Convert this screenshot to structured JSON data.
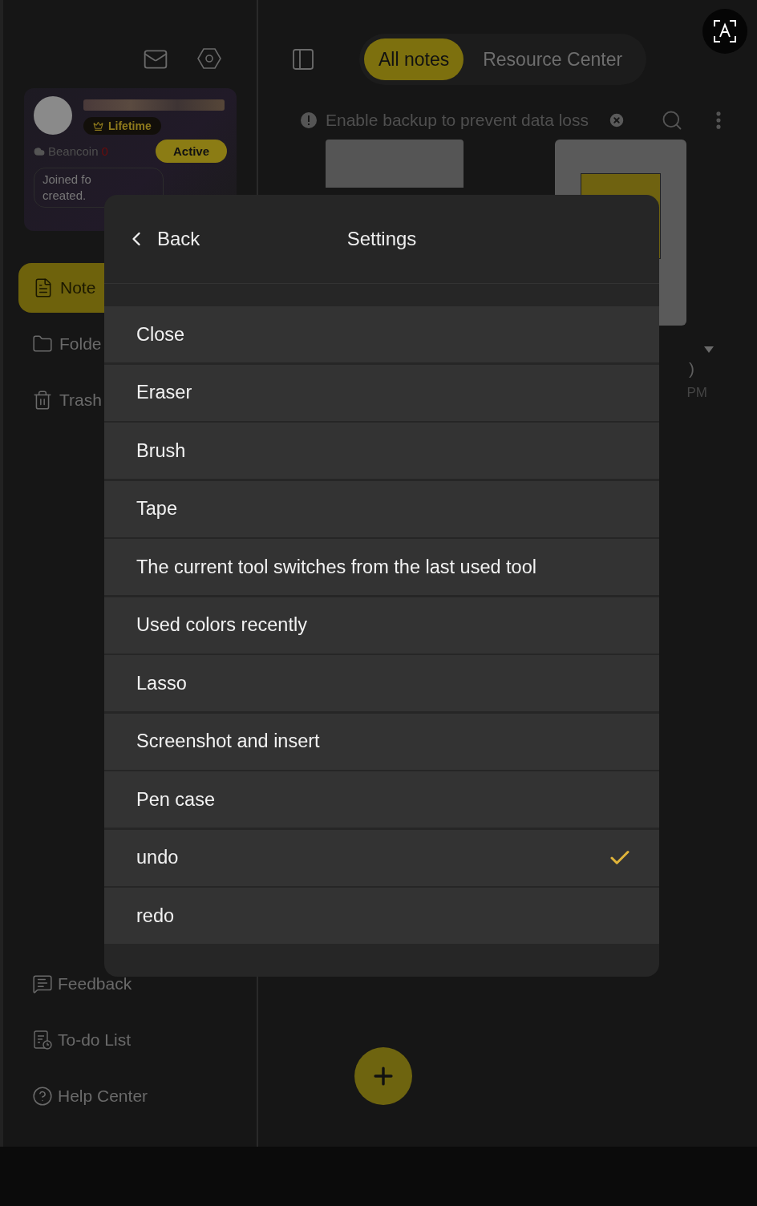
{
  "sidebar": {
    "profile": {
      "badge": "Lifetime",
      "coin_label": "Beancoin",
      "coin_count": "0",
      "status_button": "Active",
      "joined_line_1": "Joined fo",
      "joined_line_2": "created."
    },
    "nav": [
      {
        "kind": "notes",
        "label": "Note",
        "selected": true
      },
      {
        "kind": "folder",
        "label": "Folde",
        "selected": false
      },
      {
        "kind": "trash",
        "label": "Trash",
        "selected": false
      }
    ],
    "bottom_links": [
      {
        "kind": "feedback",
        "label": "Feedback"
      },
      {
        "kind": "todo",
        "label": "To-do List"
      },
      {
        "kind": "help",
        "label": "Help Center"
      }
    ]
  },
  "tabs": [
    {
      "label": "All notes",
      "selected": true
    },
    {
      "label": "Resource Center",
      "selected": false
    }
  ],
  "banner": {
    "text": "Enable backup to prevent data loss"
  },
  "note_info": {
    "line_1": ")",
    "line_2": "PM"
  },
  "settings_dialog": {
    "back": "Back",
    "title": "Settings",
    "items": [
      {
        "label": "Close",
        "checked": false
      },
      {
        "label": "Eraser",
        "checked": false
      },
      {
        "label": "Brush",
        "checked": false
      },
      {
        "label": "Tape",
        "checked": false
      },
      {
        "label": "The current tool switches from the last used tool",
        "checked": false
      },
      {
        "label": "Used colors recently",
        "checked": false
      },
      {
        "label": "Lasso",
        "checked": false
      },
      {
        "label": "Screenshot and insert",
        "checked": false
      },
      {
        "label": "Pen case",
        "checked": false
      },
      {
        "label": "undo",
        "checked": true
      },
      {
        "label": "redo",
        "checked": false
      }
    ]
  }
}
